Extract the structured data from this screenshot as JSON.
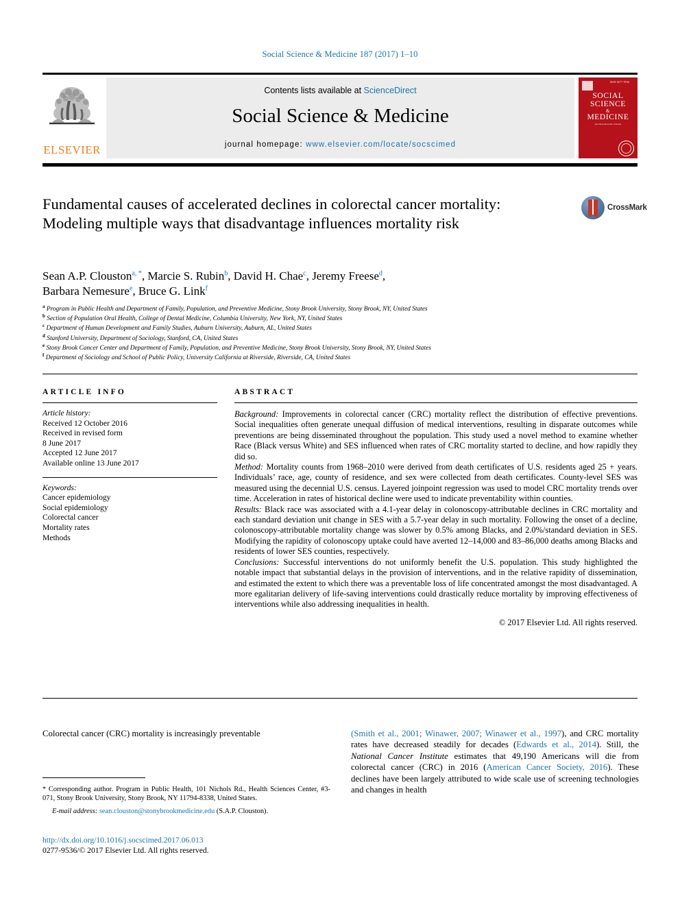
{
  "running_head": "Social Science & Medicine 187 (2017) 1–10",
  "masthead": {
    "publisher": "ELSEVIER",
    "contents_prefix": "Contents lists available at ",
    "sciencedirect": "ScienceDirect",
    "journal_title": "Social Science & Medicine",
    "homepage_prefix": "journal homepage: ",
    "homepage_url": "www.elsevier.com/locate/socscimed",
    "cover": {
      "top_label": "ISSN 0277-9536",
      "title_line1": "SOCIAL",
      "title_line2": "SCIENCE",
      "amp": "&",
      "title_line3": "MEDICINE",
      "subtitle": "An International Journal",
      "color": "#b5121b"
    }
  },
  "article": {
    "title": "Fundamental causes of accelerated declines in colorectal cancer mortality: Modeling multiple ways that disadvantage influences mortality risk",
    "crossmark_label": "CrossMark",
    "authors_line1": "Sean A.P. Clouston",
    "authors": [
      {
        "name": "Sean A.P. Clouston",
        "marks": "a, *"
      },
      {
        "name": "Marcie S. Rubin",
        "marks": "b"
      },
      {
        "name": "David H. Chae",
        "marks": "c"
      },
      {
        "name": "Jeremy Freese",
        "marks": "d"
      },
      {
        "name": "Barbara Nemesure",
        "marks": "e"
      },
      {
        "name": "Bruce G. Link",
        "marks": "f"
      }
    ],
    "affiliations": [
      {
        "mark": "a",
        "text": "Program in Public Health and Department of Family, Population, and Preventive Medicine, Stony Brook University, Stony Brook, NY, United States"
      },
      {
        "mark": "b",
        "text": "Section of Population Oral Health, College of Dental Medicine, Columbia University, New York, NY, United States"
      },
      {
        "mark": "c",
        "text": "Department of Human Development and Family Studies, Auburn University, Auburn, AL, United States"
      },
      {
        "mark": "d",
        "text": "Stanford University, Department of Sociology, Stanford, CA, United States"
      },
      {
        "mark": "e",
        "text": "Stony Brook Cancer Center and Department of Family, Population, and Preventive Medicine, Stony Brook University, Stony Brook, NY, United States"
      },
      {
        "mark": "f",
        "text": "Department of Sociology and School of Public Policy, University California at Riverside, Riverside, CA, United States"
      }
    ]
  },
  "article_info": {
    "heading": "ARTICLE INFO",
    "history_label": "Article history:",
    "history": [
      "Received 12 October 2016",
      "Received in revised form",
      "8 June 2017",
      "Accepted 12 June 2017",
      "Available online 13 June 2017"
    ],
    "keywords_label": "Keywords:",
    "keywords": [
      "Cancer epidemiology",
      "Social epidemiology",
      "Colorectal cancer",
      "Mortality rates",
      "Methods"
    ]
  },
  "abstract": {
    "heading": "ABSTRACT",
    "sections": [
      {
        "label": "Background:",
        "text": " Improvements in colorectal cancer (CRC) mortality reflect the distribution of effective preventions. Social inequalities often generate unequal diffusion of medical interventions, resulting in disparate outcomes while preventions are being disseminated throughout the population. This study used a novel method to examine whether Race (Black versus White) and SES influenced when rates of CRC mortality started to decline, and how rapidly they did so."
      },
      {
        "label": "Method:",
        "text": " Mortality counts from 1968–2010 were derived from death certificates of U.S. residents aged 25 + years. Individuals’ race, age, county of residence, and sex were collected from death certificates. County-level SES was measured using the decennial U.S. census. Layered joinpoint regression was used to model CRC mortality trends over time. Acceleration in rates of historical decline were used to indicate preventability within counties."
      },
      {
        "label": "Results:",
        "text": " Black race was associated with a 4.1-year delay in colonoscopy-attributable declines in CRC mortality and each standard deviation unit change in SES with a 5.7-year delay in such mortality. Following the onset of a decline, colonoscopy-attributable mortality change was slower by 0.5% among Blacks, and 2.0%/standard deviation in SES. Modifying the rapidity of colonoscopy uptake could have averted 12–14,000 and 83–86,000 deaths among Blacks and residents of lower SES counties, respectively."
      },
      {
        "label": "Conclusions:",
        "text": " Successful interventions do not uniformly benefit the U.S. population. This study highlighted the notable impact that substantial delays in the provision of interventions, and in the relative rapidity of dissemination, and estimated the extent to which there was a preventable loss of life concentrated amongst the most disadvantaged. A more egalitarian delivery of life-saving interventions could drastically reduce mortality by improving effectiveness of interventions while also addressing inequalities in health."
      }
    ],
    "copyright": "© 2017 Elsevier Ltd. All rights reserved."
  },
  "body": {
    "left_column": "Colorectal cancer (CRC) mortality is increasingly preventable",
    "right_column_parts": [
      {
        "kind": "link",
        "text": "("
      },
      {
        "kind": "link",
        "text": "Smith et al., 2001; Winawer, 2007; Winawer et al., 1997"
      },
      {
        "kind": "plain",
        "text": "), and CRC mortality rates have decreased steadily for decades ("
      },
      {
        "kind": "link",
        "text": "Edwards et al., 2014"
      },
      {
        "kind": "plain",
        "text": "). Still, the "
      },
      {
        "kind": "italic",
        "text": "National Cancer Institute"
      },
      {
        "kind": "plain",
        "text": " estimates that 49,190 Americans will die from colorectal cancer (CRC) in 2016 ("
      },
      {
        "kind": "link",
        "text": "American Cancer Society, 2016"
      },
      {
        "kind": "plain",
        "text": "). These declines have been largely attributed to wide scale use of screening technologies and changes in health"
      }
    ]
  },
  "footnote": {
    "star": "*",
    "text": " Corresponding author. Program in Public Health, 101 Nichols Rd., Health Sciences Center, #3-071, Stony Brook University, Stony Brook, NY 11794-8338, United States.",
    "email_label": "E-mail address:",
    "email": "sean.clouston@stonybrookmedicine.edu",
    "email_suffix": " (S.A.P. Clouston)."
  },
  "doi_block": {
    "doi_url": "http://dx.doi.org/10.1016/j.socscimed.2017.06.013",
    "issn_line": "0277-9536/© 2017 Elsevier Ltd. All rights reserved."
  },
  "colors": {
    "link": "#1b74a8",
    "elsevier_orange": "#f08021",
    "cover_red": "#b5121b",
    "band_grey": "#ececec"
  }
}
